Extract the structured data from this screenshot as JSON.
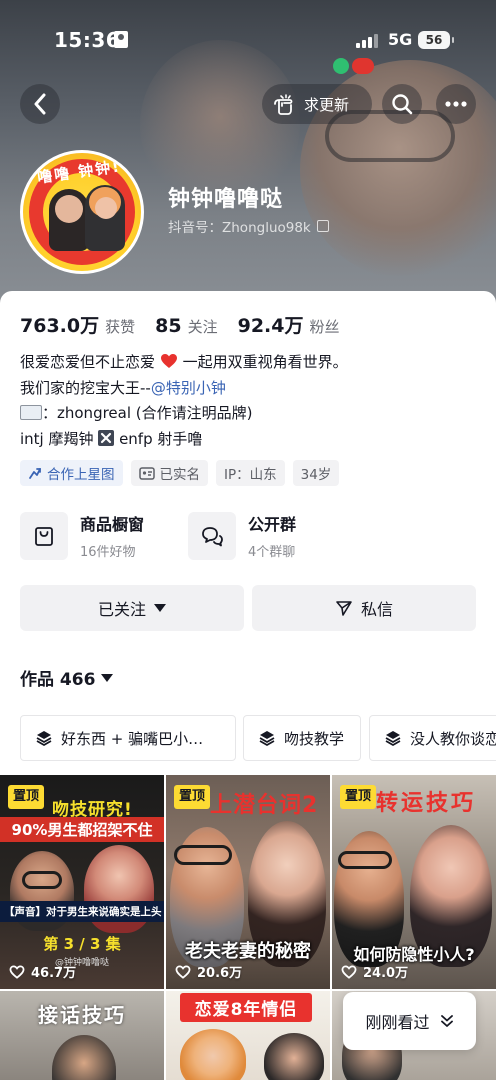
{
  "status_bar": {
    "time": "15:36",
    "network": "5G",
    "battery": "56"
  },
  "top_nav": {
    "update_label": "求更新"
  },
  "profile": {
    "nickname": "钟钟噜噜哒",
    "douyin_id": "抖音号：Zhongluo98k",
    "avatar_text": "噜噜 钟钟!"
  },
  "stats": [
    {
      "value": "763.0万",
      "label": "获赞"
    },
    {
      "value": "85",
      "label": "关注"
    },
    {
      "value": "92.4万",
      "label": "粉丝"
    }
  ],
  "bio": {
    "line1_a": "很爱恋爱但不止恋爱",
    "line1_b": "一起用双重视角看世界。",
    "line2_a": "我们家的挖宝大王--",
    "line2_mention": "@特别小钟",
    "line3": "：zhongreal (合作请注明品牌)",
    "line4_a": "intj 摩羯钟",
    "line4_b": "enfp 射手噜"
  },
  "tags": [
    "合作上星图",
    "已实名",
    "IP：山东",
    "34岁"
  ],
  "shortcuts": [
    {
      "title": "商品橱窗",
      "subtitle": "16件好物"
    },
    {
      "title": "公开群",
      "subtitle": "4个群聊"
    }
  ],
  "actions": {
    "following_label": "已关注",
    "message_label": "私信"
  },
  "works": {
    "label": "作品 466"
  },
  "collections": [
    "好东西 + 骗嘴巴小…",
    "吻技教学",
    "没人教你谈恋"
  ],
  "videos": [
    {
      "pin": "置顶",
      "title": "吻技研究!",
      "subtitle": "90%男生都招架不住",
      "caption": "【声音】对于男生来说确实是上头",
      "episode": "第 3 / 3 集",
      "handle": "@钟钟噜噜哒",
      "views": "46.7万"
    },
    {
      "pin": "置顶",
      "title": "上潜台词2",
      "caption": "老夫老妻的秘密",
      "views": "20.6万"
    },
    {
      "pin": "置顶",
      "title": "转运技巧",
      "caption": "如何防隐性小人?",
      "views": "24.0万"
    },
    {
      "title": "接话技巧"
    },
    {
      "title": "恋爱8年情侣"
    },
    {
      "title": ""
    }
  ],
  "floating_button": {
    "label": "刚刚看过"
  },
  "colors": {
    "accent_blue": "#3a64b4",
    "pin_yellow": "#fddb33",
    "heart_red": "#e8322e"
  }
}
